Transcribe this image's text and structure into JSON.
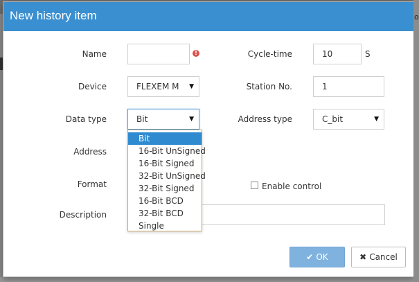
{
  "dialog": {
    "title": "New history item"
  },
  "form": {
    "name": {
      "label": "Name",
      "value": "",
      "error_icon": "!"
    },
    "cycle_time": {
      "label": "Cycle-time",
      "value": "10",
      "unit": "S"
    },
    "device": {
      "label": "Device",
      "value": "FLEXEM M"
    },
    "station_no": {
      "label": "Station No.",
      "value": "1"
    },
    "data_type": {
      "label": "Data type",
      "value": "Bit",
      "options": [
        "Bit",
        "16-Bit UnSigned",
        "16-Bit Signed",
        "32-Bit UnSigned",
        "32-Bit Signed",
        "16-Bit BCD",
        "32-Bit BCD",
        "Single"
      ],
      "selected_index": 0
    },
    "address_type": {
      "label": "Address type",
      "value": "C_bit"
    },
    "address": {
      "label": "Address"
    },
    "format": {
      "label": "Format"
    },
    "enable_control": {
      "label": "Enable control",
      "checked": false
    },
    "description": {
      "label": "Description",
      "value": ""
    }
  },
  "buttons": {
    "ok": {
      "label": "OK",
      "icon": "check-icon"
    },
    "cancel": {
      "label": "Cancel",
      "icon": "close-icon"
    }
  },
  "colors": {
    "header": "#3a8fd0",
    "selected_option": "#2f8ad0",
    "ok_button": "#7fb2de",
    "error": "#d9534f"
  }
}
